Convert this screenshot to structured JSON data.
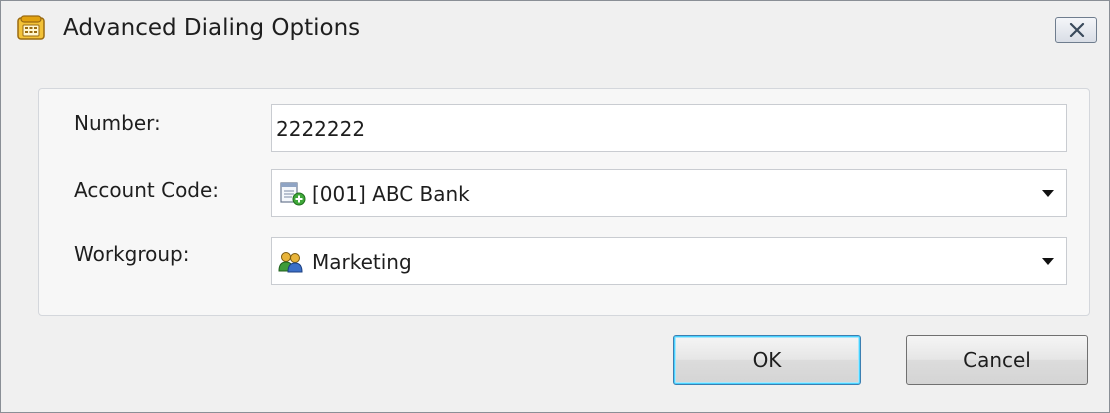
{
  "window": {
    "title": "Advanced Dialing Options",
    "title_icon": "telephone-icon",
    "close_icon": "close-icon"
  },
  "form": {
    "number": {
      "label": "Number:",
      "value": "2222222"
    },
    "account_code": {
      "label": "Account Code:",
      "selected": "[001]  ABC Bank",
      "icon": "account-code-icon"
    },
    "workgroup": {
      "label": "Workgroup:",
      "selected": "Marketing",
      "icon": "workgroup-icon"
    }
  },
  "buttons": {
    "ok": "OK",
    "cancel": "Cancel"
  },
  "colors": {
    "default_button_border": "#3c7fb1",
    "window_background": "#f0f0f0"
  }
}
